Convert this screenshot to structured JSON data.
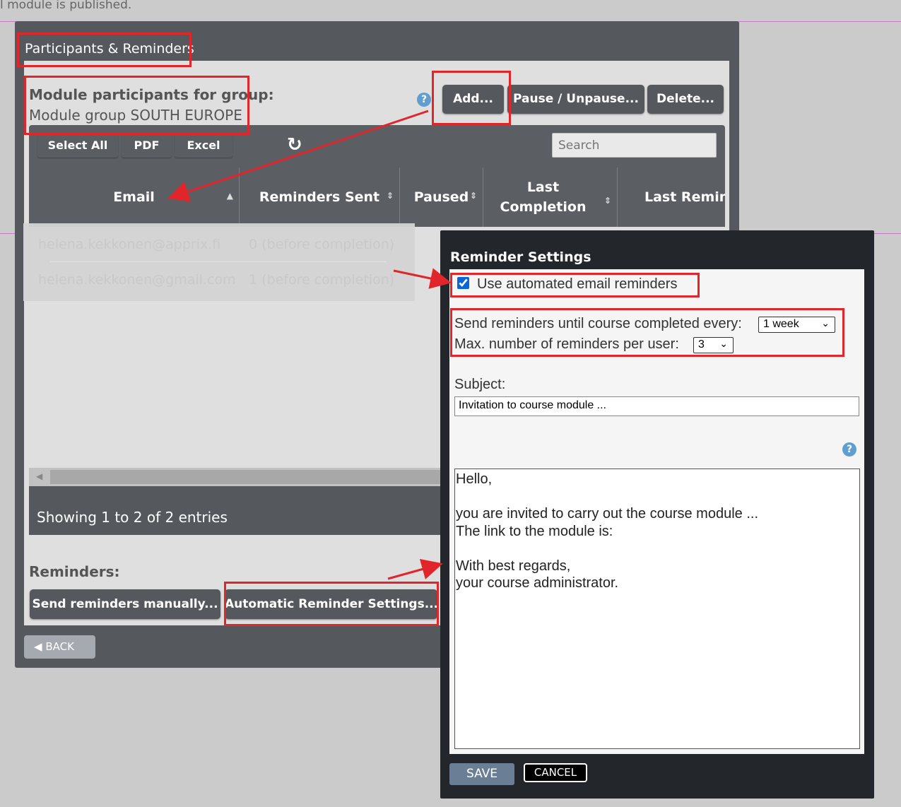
{
  "page": {
    "top_note": "l module is published."
  },
  "panel": {
    "title": "Participants & Reminders",
    "module_label": "Module participants for group:",
    "module_group": "Module group SOUTH EUROPE",
    "help_glyph": "?",
    "actions": {
      "add": "Add...",
      "pause": "Pause / Unpause...",
      "delete": "Delete..."
    }
  },
  "table": {
    "toolbar": {
      "select_all": "Select All",
      "pdf": "PDF",
      "excel": "Excel",
      "refresh_glyph": "↻",
      "search_placeholder": "Search"
    },
    "columns": [
      "Email",
      "Reminders Sent",
      "Paused",
      "Last Completion",
      "Last Remind"
    ],
    "rows": [
      {
        "email": "helena.kekkonen@apprix.fi",
        "reminders_sent": "0 (before completion)"
      },
      {
        "email": "helena.kekkonen@gmail.com",
        "reminders_sent": "1 (before completion)"
      }
    ],
    "footer": "Showing 1 to 2 of 2 entries"
  },
  "reminders": {
    "label": "Reminders:",
    "send_manually": "Send reminders manually...",
    "automatic_settings": "Automatic Reminder Settings..."
  },
  "back": {
    "label": "BACK",
    "icon_glyph": "◀"
  },
  "dialog": {
    "title": "Reminder Settings",
    "use_automated_label": "Use automated email reminders",
    "use_automated_checked": true,
    "send_every_label": "Send reminders until course completed every:",
    "send_every_value": "1 week",
    "max_reminders_label": "Max. number of reminders per user:",
    "max_reminders_value": "3",
    "subject_label": "Subject:",
    "subject_value": "Invitation to course module ...",
    "help_glyph": "?",
    "message": "Hello,\n\nyou are invited to carry out the course module ...\nThe link to the module is:\n\nWith best regards,\nyour course administrator.",
    "save": "SAVE",
    "cancel": "CANCEL"
  },
  "colors": {
    "highlight": "#e0252b",
    "panel_bg": "#55585d",
    "dialog_bg": "#23262b",
    "help_icon": "#5f9ecf",
    "save_button": "#6a7f95"
  }
}
